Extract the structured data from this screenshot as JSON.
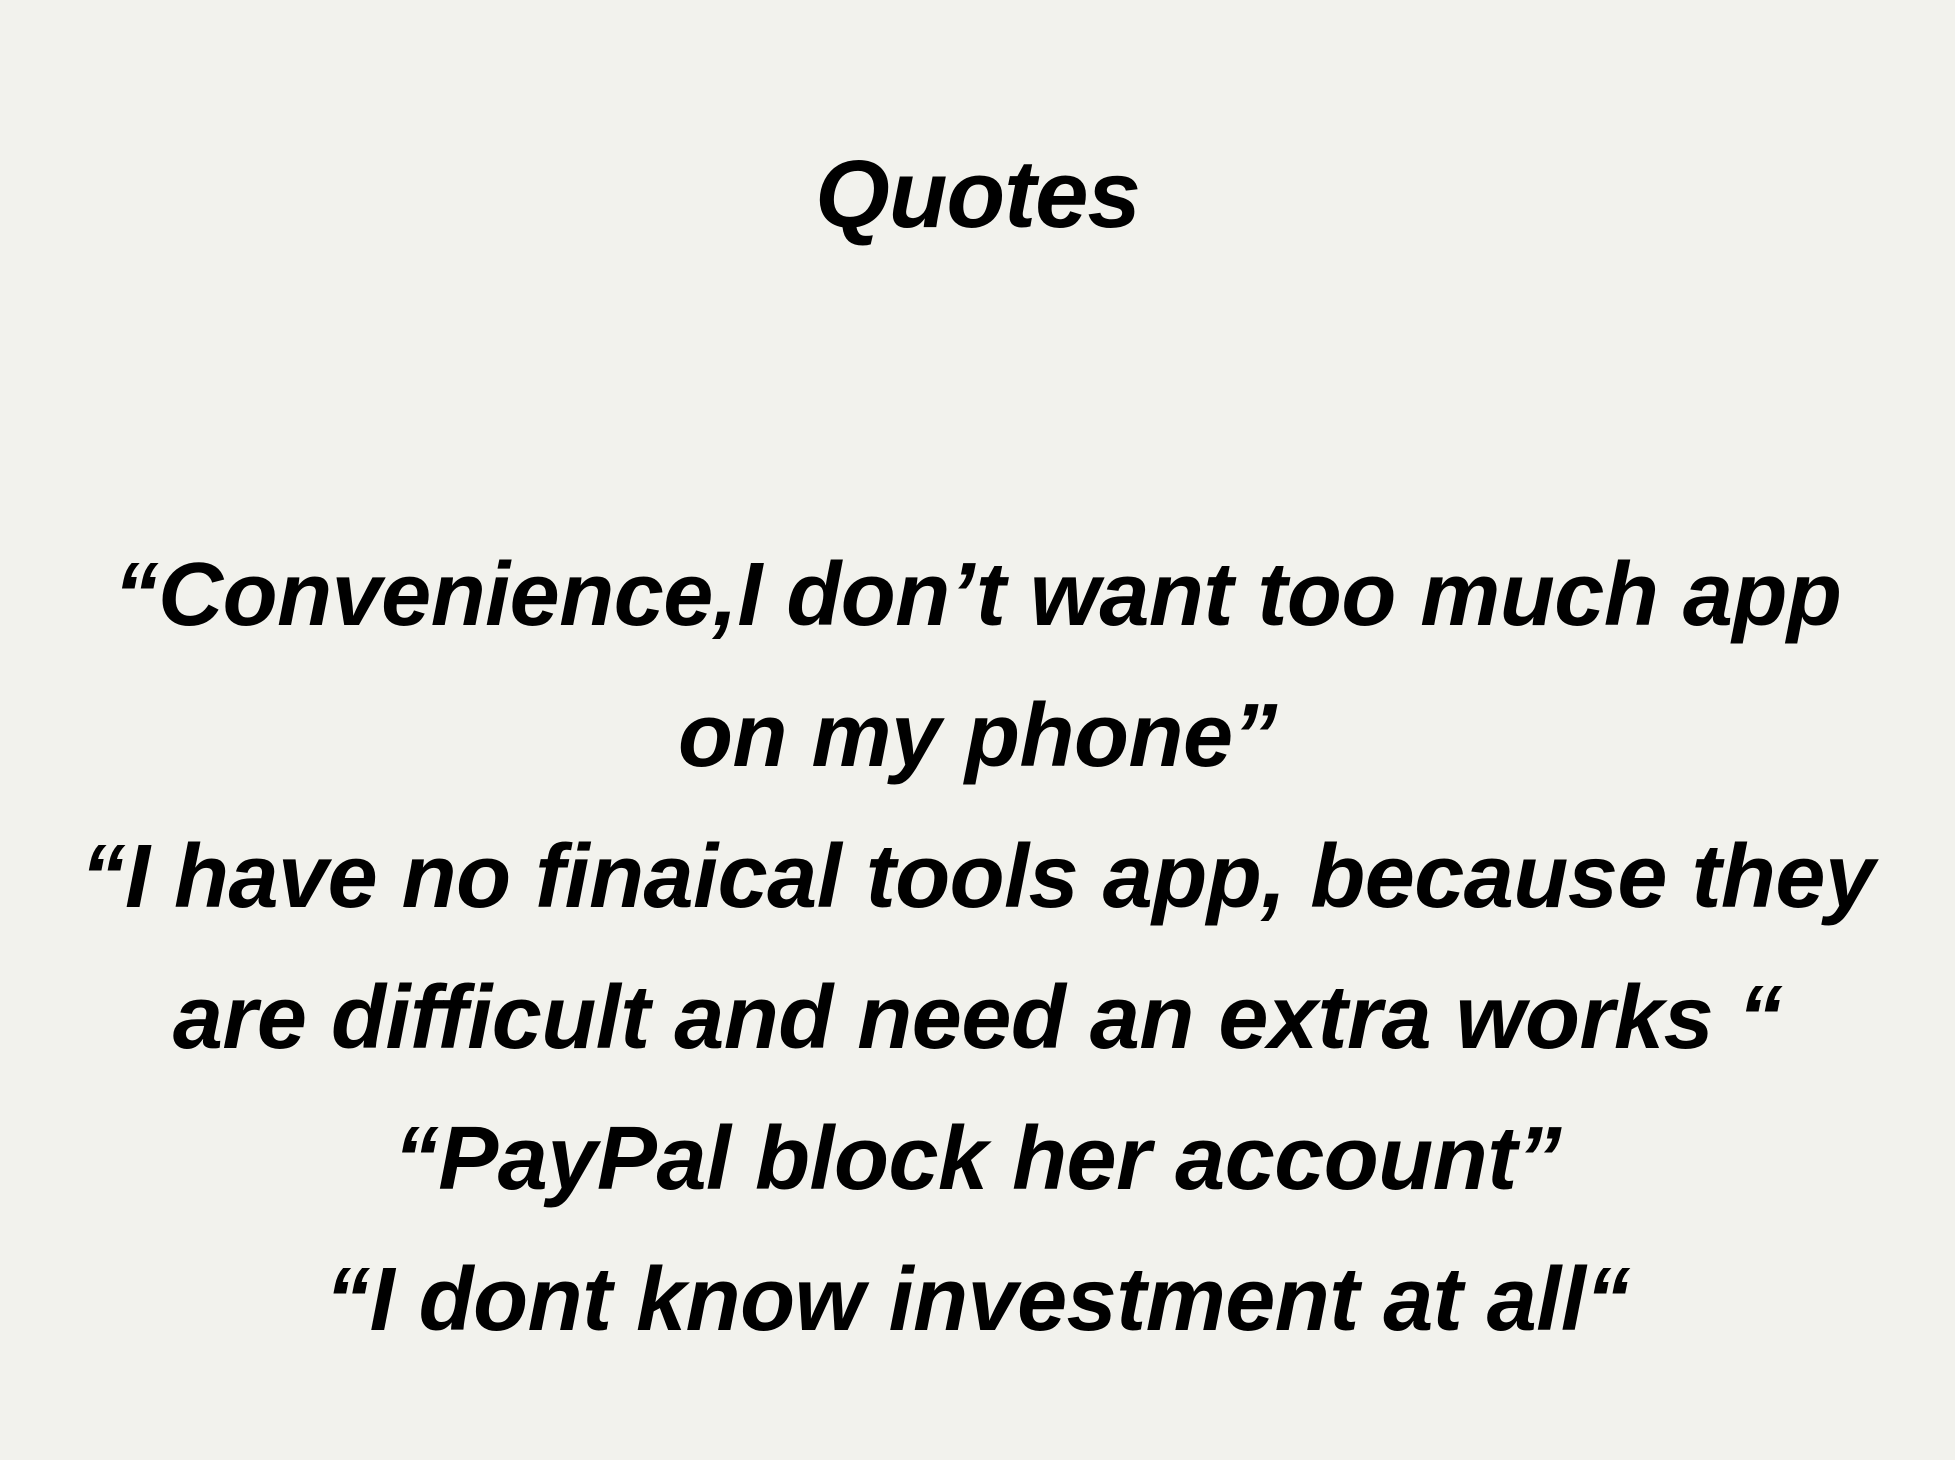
{
  "title": "Quotes",
  "quotes": [
    "“Convenience,I don’t want too much app",
    "on my phone”",
    "“I have no finaical tools app, because they",
    "are difficult and need an extra works “",
    "“PayPal block her account”",
    "“I dont know investment at all“"
  ]
}
